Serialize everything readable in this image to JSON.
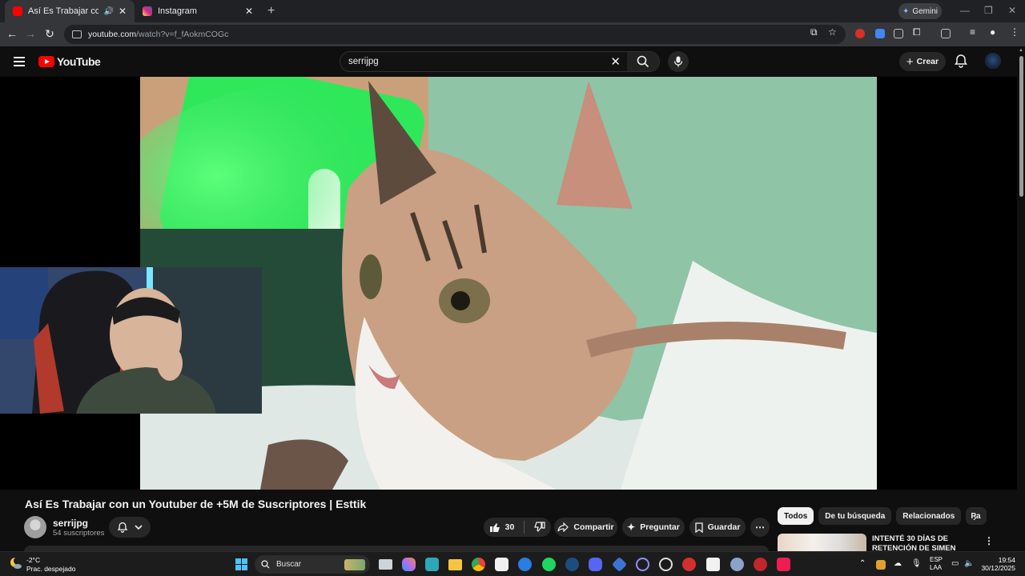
{
  "browser": {
    "tabs": [
      {
        "title": "Así Es Trabajar con un Youtube",
        "active": true,
        "favicon_color": "#ff0000",
        "audio_icon": "speaker-icon"
      },
      {
        "title": "Instagram",
        "active": false,
        "favicon_color": "#d62976"
      }
    ],
    "gemini_label": "Gemini",
    "url_host": "youtube.com",
    "url_path": "/watch?v=f_fAokmCOGc"
  },
  "youtube": {
    "logo_text": "YouTube",
    "search_value": "serrijpg",
    "create_label": "Crear"
  },
  "video": {
    "title": "Así Es Trabajar con un Youtuber de +5M de Suscriptores | Esttik",
    "channel_name": "serrijpg",
    "channel_subs": "54 suscriptores",
    "like_count": "30",
    "share_label": "Compartir",
    "ask_label": "Preguntar",
    "save_label": "Guardar"
  },
  "chips": [
    "Todos",
    "De tu búsqueda",
    "Relacionados",
    "Pa"
  ],
  "recommendation": {
    "title": "INTENTÉ 30 DÍAS DE RETENCIÓN DE SIMEN"
  },
  "taskbar": {
    "weather_temp": "-2°C",
    "weather_desc": "Prac. despejado",
    "search_label": "Buscar",
    "lang_line1": "ESP",
    "lang_line2": "LAA",
    "time": "19:54",
    "date": "30/12/2025"
  },
  "colors": {
    "accent_red": "#ff0000",
    "background": "#0f0f0f",
    "chip_active": "#f1f1f1",
    "windows_blue": "#4cc2ff"
  }
}
